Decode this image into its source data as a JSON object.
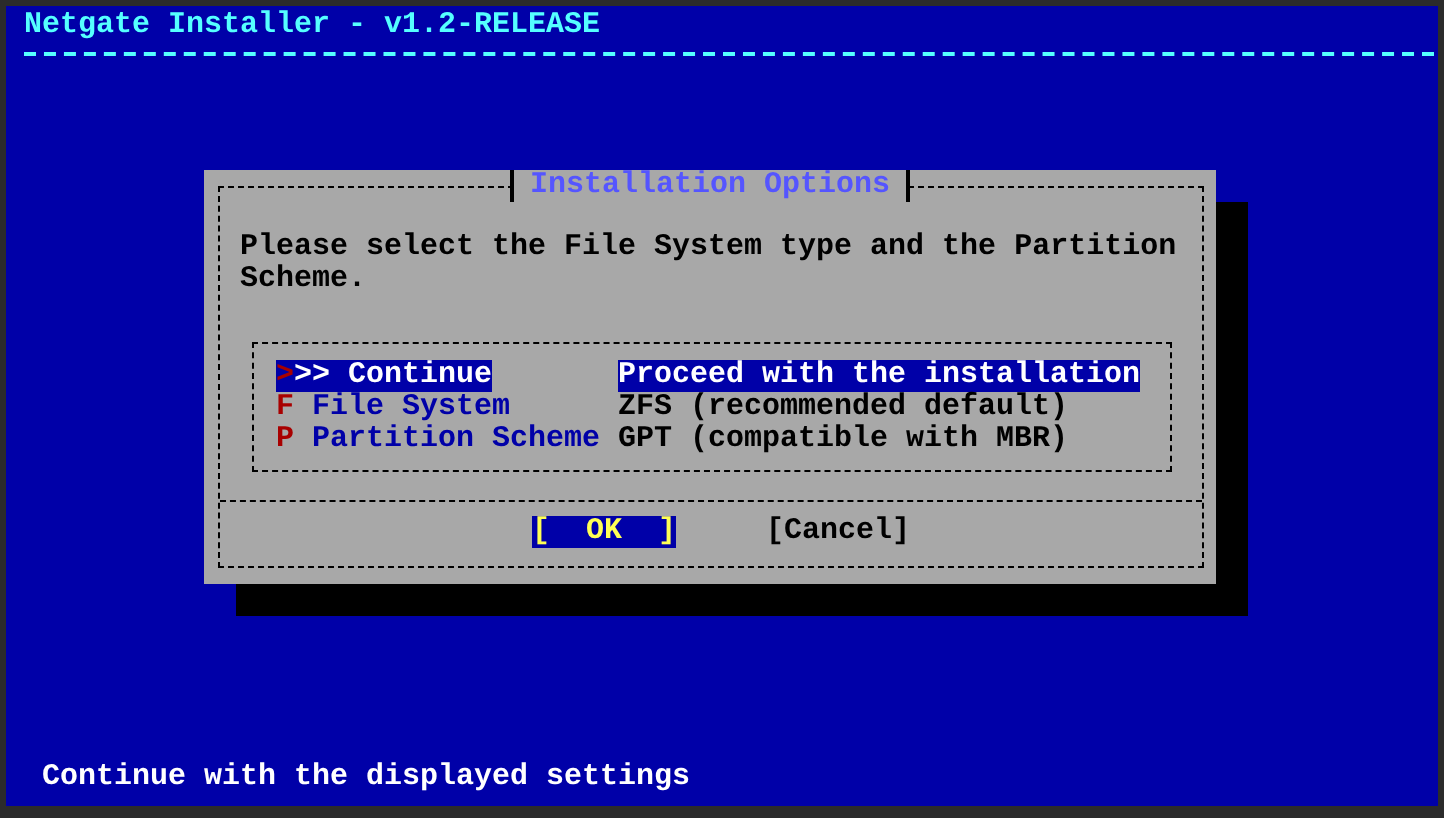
{
  "header": {
    "title": "Netgate Installer - v1.2-RELEASE"
  },
  "dialog": {
    "title": "Installation Options",
    "prompt": "Please select the File System type and the Partition Scheme.",
    "items": [
      {
        "name": ">>> Continue",
        "description": "Proceed with the installation",
        "selected": true
      },
      {
        "name": "F File System",
        "description": "ZFS (recommended default)",
        "selected": false
      },
      {
        "name": "P Partition Scheme",
        "description": "GPT (compatible with MBR)",
        "selected": false
      }
    ],
    "buttons": [
      {
        "label": "[  OK  ]",
        "selected": true
      },
      {
        "label": "[Cancel]",
        "selected": false
      }
    ]
  },
  "status_bar": {
    "text": "Continue with the displayed settings"
  }
}
